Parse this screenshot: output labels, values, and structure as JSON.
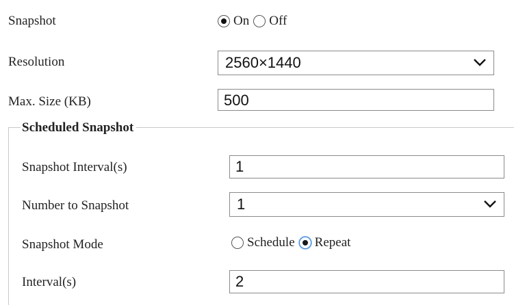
{
  "snapshot": {
    "label": "Snapshot",
    "options": [
      "On",
      "Off"
    ],
    "selected": "On"
  },
  "resolution": {
    "label": "Resolution",
    "value": "2560×1440"
  },
  "max_size": {
    "label": "Max. Size (KB)",
    "value": "500"
  },
  "scheduled": {
    "legend": "Scheduled Snapshot",
    "interval": {
      "label": "Snapshot Interval(s)",
      "value": "1"
    },
    "number": {
      "label": "Number to Snapshot",
      "value": "1"
    },
    "mode": {
      "label": "Snapshot Mode",
      "options": [
        "Schedule",
        "Repeat"
      ],
      "selected": "Repeat"
    },
    "repeat_interval": {
      "label": "Interval(s)",
      "value": "2"
    }
  },
  "colors": {
    "border": "#8a8a8a",
    "fieldset_border": "#c8c8c8",
    "radio_focus": "#3a86d6"
  }
}
